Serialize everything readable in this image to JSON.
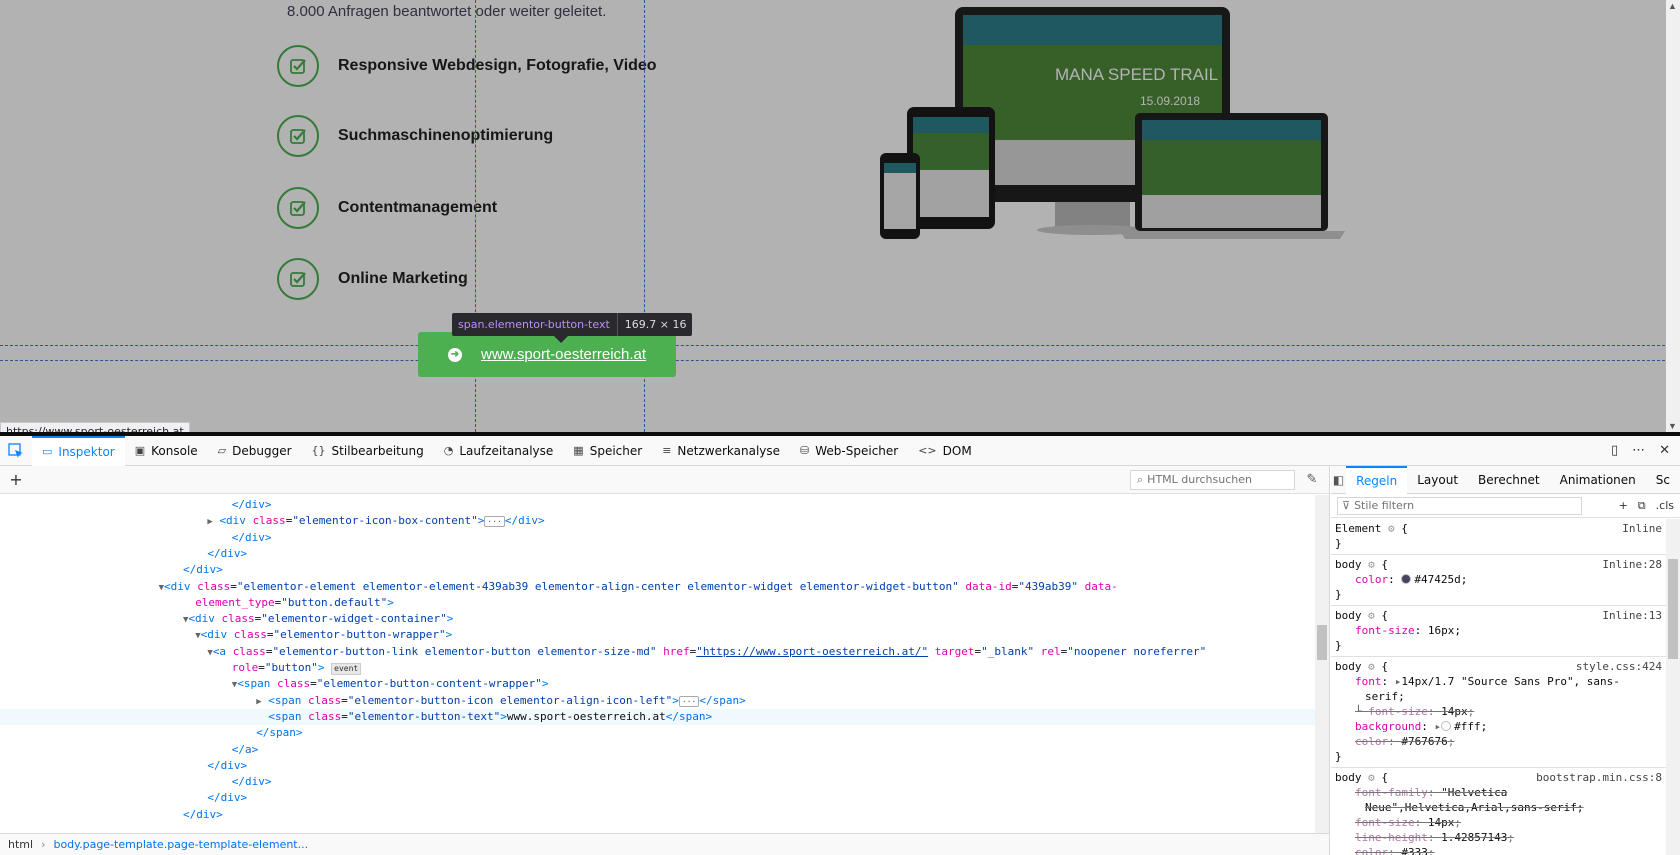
{
  "page": {
    "intro_text": "8.000 Anfragen beantwortet oder weiter geleitet.",
    "features": [
      {
        "label": "Responsive Webdesign, Fotografie, Video",
        "icon": "check-square-icon"
      },
      {
        "label": "Suchmaschinenoptimierung",
        "icon": "check-square-icon"
      },
      {
        "label": "Contentmanagement",
        "icon": "check-square-icon"
      },
      {
        "label": "Online Marketing",
        "icon": "check-square-icon"
      }
    ],
    "image_text": {
      "title": "MANA SPEED TRAIL",
      "date": "15.09.2018"
    },
    "cta_text": "www.sport-oesterreich.at",
    "accent_color": "#4caf50"
  },
  "tooltip": {
    "selector": "span.elementor-button-text",
    "size": "169.7 × 16"
  },
  "status_link": "https://www.sport-oesterreich.at",
  "devtools": {
    "tabs": [
      {
        "label": "Inspektor",
        "icon": "inspector-icon",
        "active": true
      },
      {
        "label": "Konsole",
        "icon": "console-icon"
      },
      {
        "label": "Debugger",
        "icon": "debugger-icon"
      },
      {
        "label": "Stilbearbeitung",
        "icon": "braces-icon"
      },
      {
        "label": "Laufzeitanalyse",
        "icon": "performance-icon"
      },
      {
        "label": "Speicher",
        "icon": "memory-icon"
      },
      {
        "label": "Netzwerkanalyse",
        "icon": "network-icon"
      },
      {
        "label": "Web-Speicher",
        "icon": "storage-icon"
      },
      {
        "label": "DOM",
        "icon": "dom-icon"
      }
    ],
    "search_placeholder": "HTML durchsuchen",
    "breadcrumb": {
      "html": "html",
      "body": "body.page-template.page-template-element..."
    },
    "markup_lines": [
      {
        "indent": 19,
        "html": "<span class=\"tag\">&lt;/div&gt;</span>"
      },
      {
        "indent": 17,
        "html": "<span class=\"twisty\">▶</span> <span class=\"tag\">&lt;div</span> <span class=\"an\">class</span>=<span class=\"av\">\"elementor-icon-box-content\"</span><span class=\"tag\">&gt;</span><span class=\"dots\">···</span><span class=\"tag\">&lt;/div&gt;</span>"
      },
      {
        "indent": 19,
        "html": "<span class=\"tag\">&lt;/div&gt;</span>"
      },
      {
        "indent": 17,
        "html": "<span class=\"tag\">&lt;/div&gt;</span>"
      },
      {
        "indent": 15,
        "html": "<span class=\"tag\">&lt;/div&gt;</span>"
      },
      {
        "indent": 13,
        "html": "<span class=\"twisty\">▼</span><span class=\"tag\">&lt;div</span> <span class=\"an\">class</span>=<span class=\"av\">\"elementor-element elementor-element-439ab39 elementor-align-center elementor-widget elementor-widget-button\"</span> <span class=\"an\">data-id</span>=<span class=\"av\">\"439ab39\"</span> <span class=\"an\">data-</span>"
      },
      {
        "indent": 16,
        "html": "<span class=\"an\">element_type</span>=<span class=\"av\">\"button.default\"</span><span class=\"tag\">&gt;</span>"
      },
      {
        "indent": 15,
        "html": "<span class=\"twisty\">▼</span><span class=\"tag\">&lt;div</span> <span class=\"an\">class</span>=<span class=\"av\">\"elementor-widget-container\"</span><span class=\"tag\">&gt;</span>"
      },
      {
        "indent": 16,
        "html": "<span class=\"twisty\">▼</span><span class=\"tag\">&lt;div</span> <span class=\"an\">class</span>=<span class=\"av\">\"elementor-button-wrapper\"</span><span class=\"tag\">&gt;</span>"
      },
      {
        "indent": 17,
        "html": "<span class=\"twisty\">▼</span><span class=\"tag\">&lt;a</span> <span class=\"an\">class</span>=<span class=\"av\">\"elementor-button-link elementor-button elementor-size-md\"</span> <span class=\"an\">href</span>=<span class=\"av\" style=\"text-decoration:underline\">\"https://www.sport-oesterreich.at/\"</span> <span class=\"an\">target</span>=<span class=\"av\">\"_blank\"</span> <span class=\"an\">rel</span>=<span class=\"av\">\"noopener noreferrer\"</span>"
      },
      {
        "indent": 19,
        "html": "<span class=\"an\">role</span>=<span class=\"av\">\"button\"</span><span class=\"tag\">&gt;</span> <span class=\"evbadge\">event</span>"
      },
      {
        "indent": 19,
        "html": "<span class=\"twisty\">▼</span><span class=\"tag\">&lt;span</span> <span class=\"an\">class</span>=<span class=\"av\">\"elementor-button-content-wrapper\"</span><span class=\"tag\">&gt;</span>"
      },
      {
        "indent": 21,
        "html": "<span class=\"twisty\">▶</span> <span class=\"tag\">&lt;span</span> <span class=\"an\">class</span>=<span class=\"av\">\"elementor-button-icon elementor-align-icon-left\"</span><span class=\"tag\">&gt;</span><span class=\"dots\">···</span><span class=\"tag\">&lt;/span&gt;</span>"
      },
      {
        "indent": 22,
        "selected": true,
        "html": "<span class=\"tag\">&lt;span</span> <span class=\"an\">class</span>=<span class=\"av\">\"elementor-button-text\"</span><span class=\"tag\">&gt;</span>www.sport-oesterreich.at<span class=\"tag\">&lt;/span&gt;</span>"
      },
      {
        "indent": 21,
        "html": "<span class=\"tag\">&lt;/span&gt;</span>"
      },
      {
        "indent": 19,
        "html": "<span class=\"tag\">&lt;/a&gt;</span>"
      },
      {
        "indent": 17,
        "html": "<span class=\"tag\">&lt;/div&gt;</span>"
      },
      {
        "indent": 19,
        "html": "<span class=\"tag\">&lt;/div&gt;</span>"
      },
      {
        "indent": 17,
        "html": "<span class=\"tag\">&lt;/div&gt;</span>"
      },
      {
        "indent": 15,
        "html": "<span class=\"tag\">&lt;/div&gt;</span>"
      }
    ],
    "rules_tabs": [
      "Regeln",
      "Layout",
      "Berechnet",
      "Animationen",
      "Sc"
    ],
    "rules_filter_placeholder": "Stile filtern",
    "rules_cls": ".cls",
    "rules": [
      {
        "selector": "Element",
        "source": "Inline",
        "decls": []
      },
      {
        "selector": "body",
        "source": "Inline:28",
        "decls": [
          {
            "prop": "color",
            "value": "#47425d",
            "swatch": "#47425d"
          }
        ]
      },
      {
        "selector": "body",
        "source": "Inline:13",
        "decls": [
          {
            "prop": "font-size",
            "value": "16px"
          }
        ]
      },
      {
        "selector": "body",
        "source": "style.css:424",
        "decls": [
          {
            "prop": "font",
            "value": "14px/1.7 \"Source Sans Pro\", sans-",
            "cont": "serif;",
            "expand": true
          },
          {
            "prop": "font-size",
            "value": "14px",
            "struck": true,
            "sub": true
          },
          {
            "prop": "background",
            "value": "#fff",
            "swatch": "#ffffff",
            "expand": true
          },
          {
            "prop": "color",
            "value": "#767676",
            "struck": true
          }
        ]
      },
      {
        "selector": "body",
        "source": "bootstrap.min.css:8",
        "decls": [
          {
            "prop": "font-family",
            "value": "\"Helvetica",
            "cont": "Neue\",Helvetica,Arial,sans-serif;",
            "struck": true
          },
          {
            "prop": "font-size",
            "value": "14px",
            "struck": true
          },
          {
            "prop": "line-height",
            "value": "1.42857143",
            "struck": true
          },
          {
            "prop": "color",
            "value": "#333",
            "struck": true
          }
        ]
      }
    ]
  }
}
